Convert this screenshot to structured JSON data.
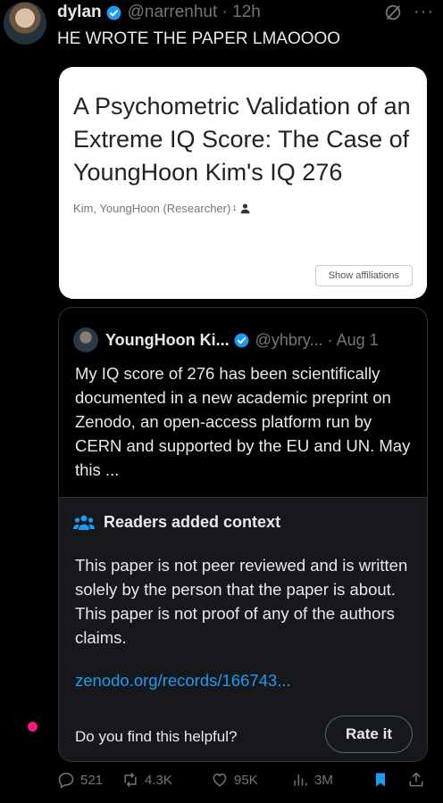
{
  "tweet": {
    "author_name": "dylan",
    "handle_time": "@narrenhut · 12h",
    "text": "HE WROTE THE PAPER LMAOOOO"
  },
  "paper": {
    "title": "A Psychometric Validation of an Extreme IQ Score: The Case of YoungHoon Kim's IQ 276",
    "author": "Kim, YoungHoon (Researcher)",
    "author_sup": "1",
    "affiliations_button": "Show affiliations"
  },
  "quoted": {
    "name": "YoungHoon Ki...",
    "handle_time": "@yhbry... · Aug 1",
    "text": "My IQ score of 276 has been scientifically documented in a new academic preprint on Zenodo, an open-access platform run by CERN and supported by the EU and UN. May this ..."
  },
  "context": {
    "heading": "Readers added context",
    "text": "This paper is not peer reviewed and is written solely by the person that the paper is about. This paper is not proof of any of the authors claims.",
    "link": "zenodo.org/records/166743...",
    "helpful_prompt": "Do you find this helpful?",
    "rate_button": "Rate it"
  },
  "actions": {
    "replies": "521",
    "reposts": "4.3K",
    "likes": "95K",
    "views": "3M"
  },
  "colors": {
    "accent": "#1d9bf0",
    "muted": "#71767b",
    "dot": "#f91880"
  }
}
